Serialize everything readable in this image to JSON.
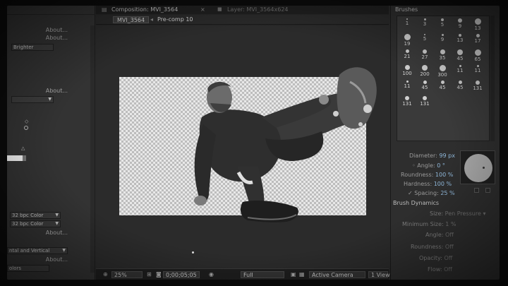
{
  "left_panel": {
    "links": [
      "About...",
      "About...",
      "About...",
      "About...",
      "About..."
    ],
    "dropdown_brighter": "Brighter",
    "dropdown_color_1": "32 bpc Color",
    "dropdown_color_2": "32 bpc Color",
    "dropdown_axis": "ntal and Vertical",
    "dropdown_bottom": "olors"
  },
  "comp": {
    "tabs": {
      "composition": "Composition: MVI_3564",
      "layer": "Layer: MVI_3564x624"
    },
    "chips": {
      "comp": "MVI_3564",
      "precomp": "Pre-comp 10"
    },
    "footer": {
      "zoom": "25%",
      "timecode": "0;00;05;05",
      "resolution": "Full",
      "camera": "Active Camera",
      "views": "1 View"
    }
  },
  "brushes": {
    "title": "Brushes",
    "cells": [
      {
        "size": "1"
      },
      {
        "size": "3"
      },
      {
        "size": "5"
      },
      {
        "size": "9"
      },
      {
        "size": "13"
      },
      {
        "size": "19"
      },
      {
        "size": "5"
      },
      {
        "size": "9"
      },
      {
        "size": "13"
      },
      {
        "size": "17"
      },
      {
        "size": "21"
      },
      {
        "size": "27"
      },
      {
        "size": "35"
      },
      {
        "size": "45"
      },
      {
        "size": "65"
      },
      {
        "size": "100"
      },
      {
        "size": "200"
      },
      {
        "size": "300"
      },
      {
        "size": "11"
      },
      {
        "size": "11"
      },
      {
        "size": "11"
      },
      {
        "size": "45"
      },
      {
        "size": "45"
      },
      {
        "size": "45"
      },
      {
        "size": "131"
      },
      {
        "size": "131"
      },
      {
        "size": "131"
      }
    ],
    "props": {
      "diameter_label": "Diameter:",
      "diameter_value": "99 px",
      "angle_label": "Angle:",
      "angle_value": "0 °",
      "roundness_label": "Roundness:",
      "roundness_value": "100 %",
      "hardness_label": "Hardness:",
      "hardness_value": "100 %",
      "spacing_label": "Spacing:",
      "spacing_value": "25 %"
    },
    "dynamics": {
      "title": "Brush Dynamics",
      "rows": [
        {
          "label": "Size:",
          "value": "Pen Pressure"
        },
        {
          "label": "Minimum Size:",
          "value": "1 %"
        },
        {
          "label": "Angle:",
          "value": "Off"
        },
        {
          "label": "Roundness:",
          "value": "Off"
        },
        {
          "label": "Opacity:",
          "value": "Off"
        },
        {
          "label": "Flow:",
          "value": "Off"
        }
      ]
    }
  }
}
